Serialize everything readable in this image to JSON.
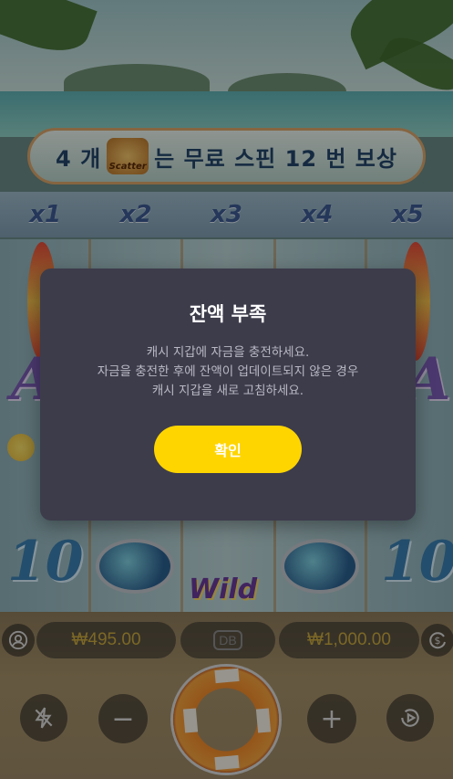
{
  "banner": {
    "text_before": "4 개",
    "scatter_label": "Scatter",
    "text_after": "는 무료 스핀 12 번 보상"
  },
  "multipliers": [
    "x1",
    "x2",
    "x3",
    "x4",
    "x5"
  ],
  "reels": {
    "symbol_10": "10",
    "symbol_A": "A",
    "wild_label": "Wild"
  },
  "controls": {
    "balance": "₩495.00",
    "bet": "₩1,000.00",
    "center_badge": "DB",
    "minus_label": "−",
    "plus_label": "+"
  },
  "dialog": {
    "title": "잔액 부족",
    "message_lines": [
      "캐시 지갑에 자금을 충전하세요.",
      "자금을 충전한 후에 잔액이 업데이트되지 않은 경우",
      "캐시 지갑을 새로 고침하세요."
    ],
    "confirm_label": "확인"
  },
  "colors": {
    "modal_bg": "#3d3c4b",
    "confirm_button": "#ffd500",
    "currency_text": "#c9a93e"
  },
  "icons": {
    "account": "account-icon",
    "balance_refresh": "dollar-refresh-icon",
    "turbo": "turbo-off-icon",
    "autoplay": "autoplay-icon",
    "spin": "life-ring-spin-icon"
  }
}
